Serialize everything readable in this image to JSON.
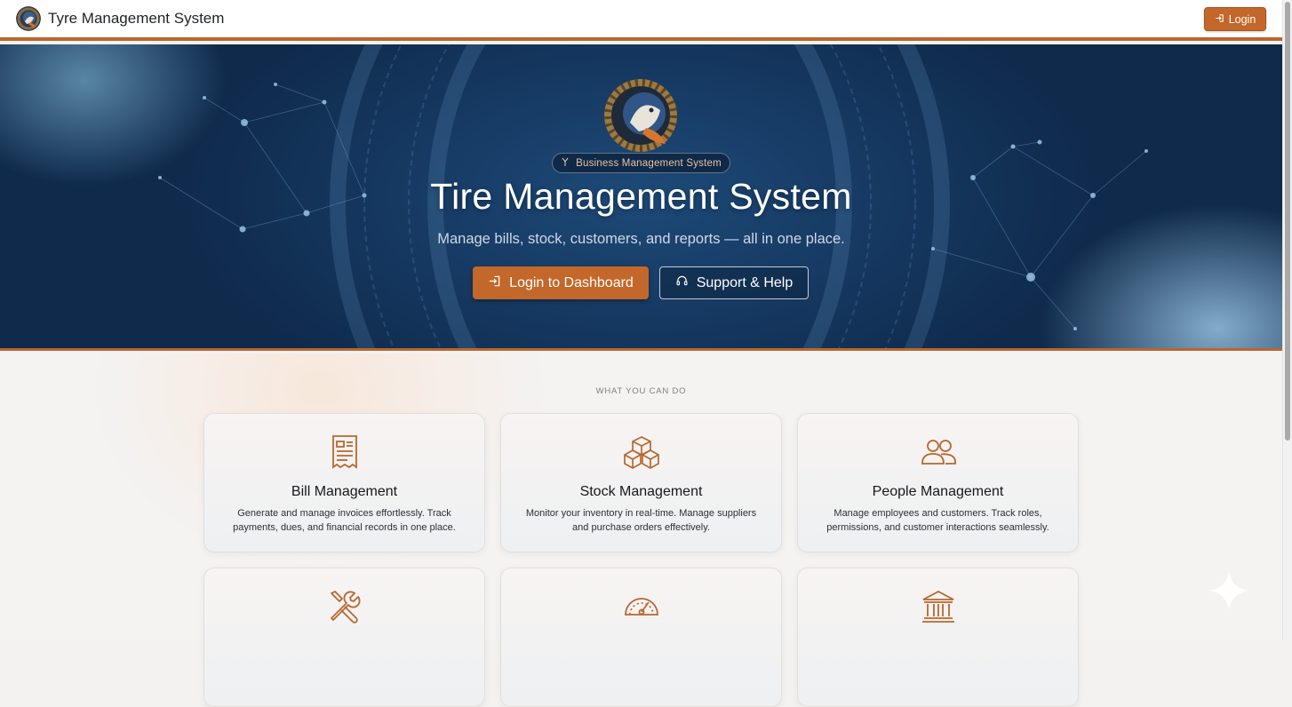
{
  "navbar": {
    "brand_title": "Tyre Management System",
    "login_label": "Login"
  },
  "hero": {
    "badge": "Business Management System",
    "title": "Tire Management System",
    "subtitle": "Manage bills, stock, customers, and reports — all in one place.",
    "primary_button": "Login to Dashboard",
    "secondary_button": "Support & Help"
  },
  "features": {
    "section_label": "WHAT YOU CAN DO",
    "cards": [
      {
        "title": "Bill Management",
        "description": "Generate and manage invoices effortlessly. Track payments, dues, and financial records in one place.",
        "icon": "receipt-icon"
      },
      {
        "title": "Stock Management",
        "description": "Monitor your inventory in real-time. Manage suppliers and purchase orders effectively.",
        "icon": "boxes-icon"
      },
      {
        "title": "People Management",
        "description": "Manage employees and customers. Track roles, permissions, and customer interactions seamlessly.",
        "icon": "people-icon"
      },
      {
        "title": "",
        "description": "",
        "icon": "tools-icon"
      },
      {
        "title": "",
        "description": "",
        "icon": "speedometer-icon"
      },
      {
        "title": "",
        "description": "",
        "icon": "bank-icon"
      }
    ]
  },
  "colors": {
    "accent": "#c4672a",
    "hero_bg": "#163a63",
    "page_bg": "#f4f3f2"
  }
}
